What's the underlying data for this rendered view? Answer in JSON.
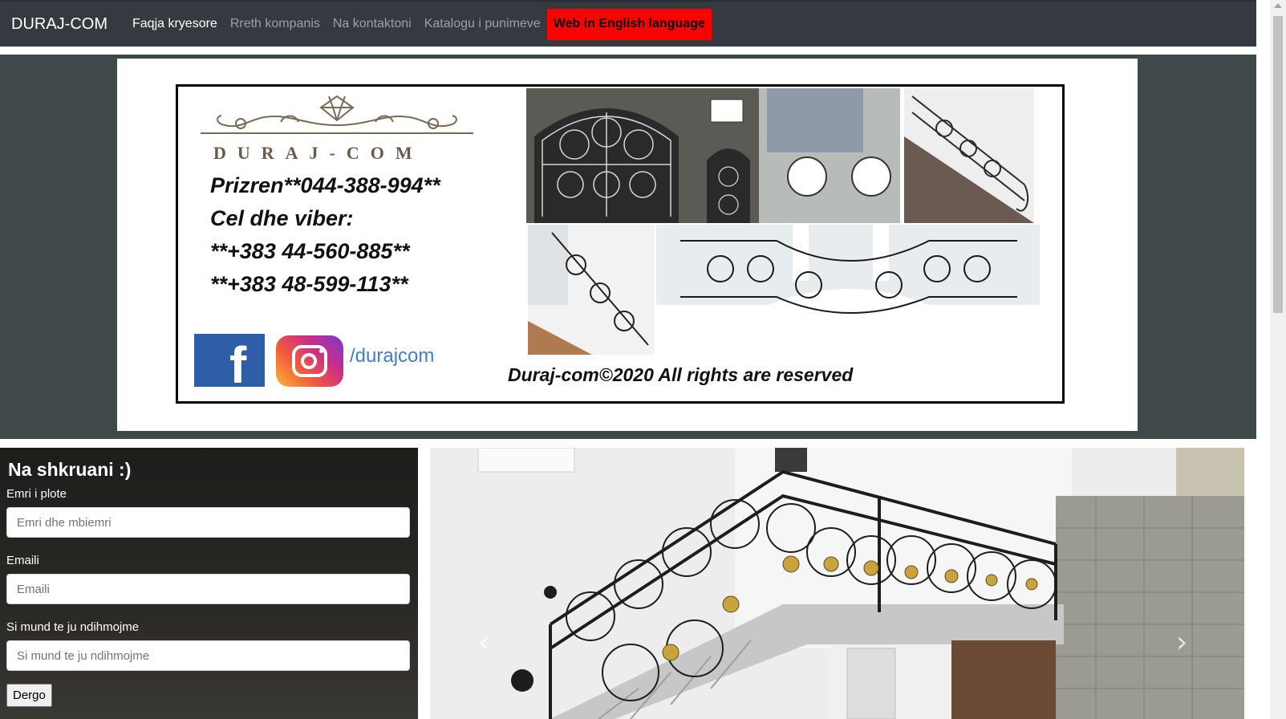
{
  "navbar": {
    "brand": "DURAJ-COM",
    "links": [
      {
        "label": "Faqja kryesore",
        "active": true
      },
      {
        "label": "Rreth kompanis",
        "active": false
      },
      {
        "label": "Na kontaktoni",
        "active": false
      },
      {
        "label": "Katalogu i punimeve",
        "active": false
      }
    ],
    "english_link": "Web in English language"
  },
  "banner": {
    "logo_text": "DURAJ-COM",
    "line1": "Prizren**044-388-994**",
    "line2": "Cel dhe viber:",
    "line3": "**+383 44-560-885**",
    "line4": "**+383 48-599-113**",
    "social_handle": "/durajcom",
    "copyright": "Duraj-com©2020 All rights are reserved",
    "facebook_icon": "facebook-icon",
    "instagram_icon": "instagram-icon"
  },
  "contact": {
    "title": "Na shkruani :)",
    "name_label": "Emri i plote",
    "name_placeholder": "Emri dhe mbiemri",
    "email_label": "Emaili",
    "email_placeholder": "Emaili",
    "help_label": "Si mund te ju ndihmojme",
    "help_placeholder": "Si mund te ju ndihmojme",
    "send_label": "Dergo"
  },
  "carousel": {
    "prev_icon": "chevron-left-icon",
    "next_icon": "chevron-right-icon",
    "prev_glyph": "‹",
    "next_glyph": "›"
  },
  "colors": {
    "navbar": "#343a40",
    "hero_bg": "#3f4949",
    "english_button": "#ff0000",
    "contact_bg": "#1d1d1b"
  }
}
